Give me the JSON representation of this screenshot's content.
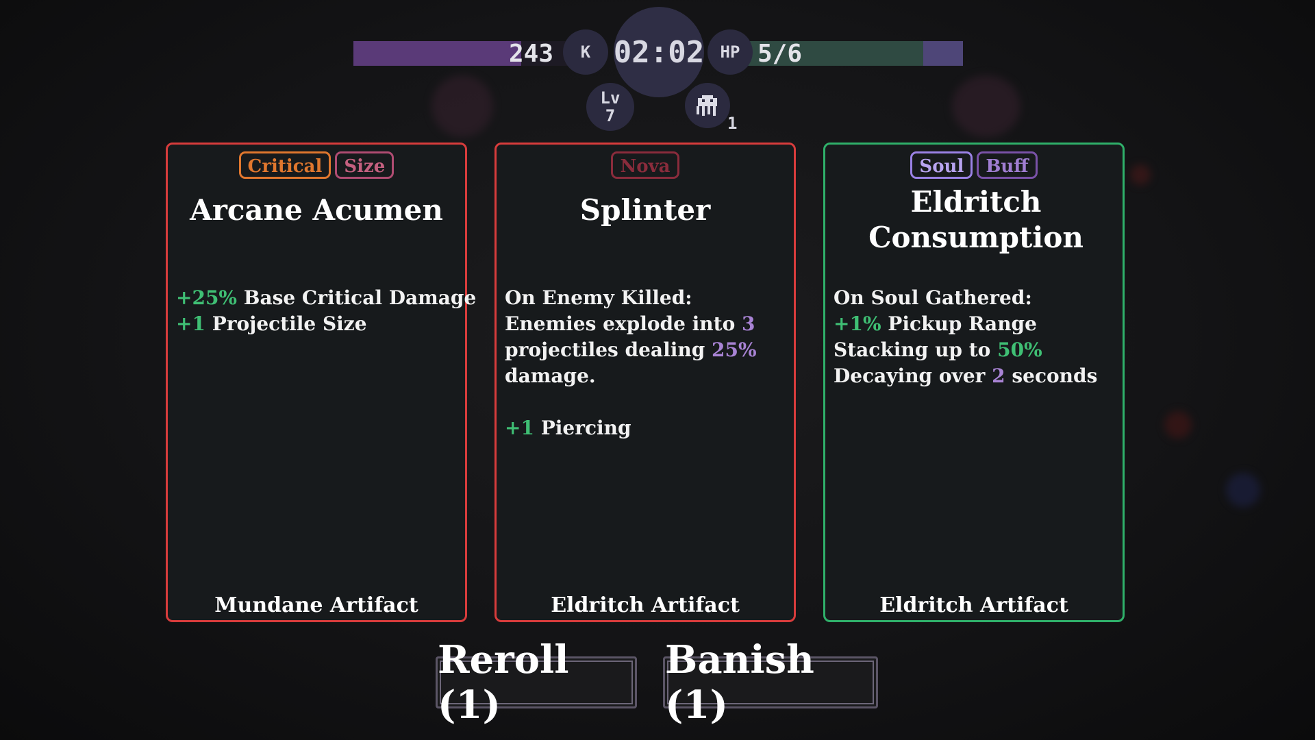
{
  "hud": {
    "xp_value": "243",
    "xp_progress": 0.78,
    "k_label": "K",
    "timer": "02:02",
    "hp_label": "HP",
    "hp_value": "5/6",
    "hp_progress": 0.8333,
    "level_label": "Lv",
    "level_value": "7",
    "item_icon": "ghost-creature-icon",
    "item_count": "1"
  },
  "cards": [
    {
      "tags": [
        "Critical",
        "Size"
      ],
      "title": "Arcane Acumen",
      "lines": [
        [
          {
            "t": "+25%",
            "c": "g"
          },
          {
            "t": " Base Critical Damage"
          }
        ],
        [
          {
            "t": "+1",
            "c": "g"
          },
          {
            "t": " Projectile Size"
          }
        ]
      ],
      "rarity": "Mundane Artifact"
    },
    {
      "tags": [
        "Nova"
      ],
      "title": "Splinter",
      "lines": [
        [
          {
            "t": "On Enemy Killed:"
          }
        ],
        [
          {
            "t": "Enemies explode into "
          },
          {
            "t": "3",
            "c": "p"
          }
        ],
        [
          {
            "t": "projectiles dealing "
          },
          {
            "t": "25%",
            "c": "p"
          }
        ],
        [
          {
            "t": "damage."
          }
        ],
        [],
        [
          {
            "t": "+1",
            "c": "g"
          },
          {
            "t": " Piercing"
          }
        ]
      ],
      "rarity": "Eldritch Artifact"
    },
    {
      "tags": [
        "Soul",
        "Buff"
      ],
      "title": "Eldritch Consumption",
      "lines": [
        [
          {
            "t": "On Soul Gathered:"
          }
        ],
        [
          {
            "t": "+1%",
            "c": "g"
          },
          {
            "t": " Pickup Range"
          }
        ],
        [
          {
            "t": "Stacking up to "
          },
          {
            "t": "50%",
            "c": "g"
          }
        ],
        [
          {
            "t": "Decaying over "
          },
          {
            "t": "2",
            "c": "p"
          },
          {
            "t": " seconds"
          }
        ]
      ],
      "rarity": "Eldritch Artifact"
    }
  ],
  "buttons": {
    "reroll": "Reroll (1)",
    "banish": "Banish (1)"
  },
  "colors": {
    "card_border_red": "#d83c3c",
    "card_border_green": "#2fb06a",
    "value_green": "#3fbf74",
    "value_purple": "#a883d4"
  }
}
